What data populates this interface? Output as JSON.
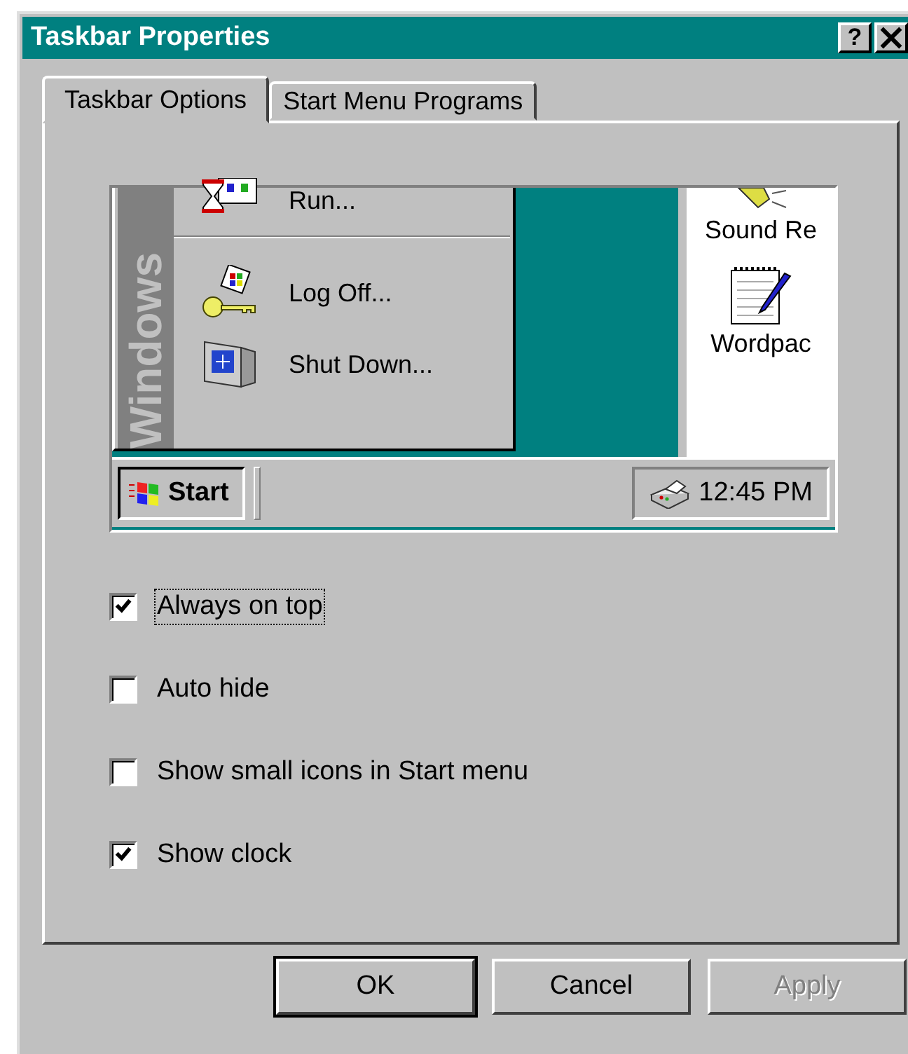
{
  "window": {
    "title": "Taskbar Properties",
    "help_button": "?"
  },
  "tabs": [
    {
      "label": "Taskbar Options",
      "selected": true
    },
    {
      "label": "Start Menu Programs",
      "selected": false
    }
  ],
  "preview": {
    "banner": "Windows",
    "menu_items": [
      {
        "label": "Run...",
        "kind": "run"
      },
      {
        "label": "Log Off...",
        "kind": "logoff"
      },
      {
        "label": "Shut Down...",
        "kind": "shutdown"
      }
    ],
    "desktop_icons": [
      {
        "label": "Sound Re",
        "kind": "speaker"
      },
      {
        "label": "Wordpac",
        "kind": "notepad"
      }
    ],
    "start_button": "Start",
    "clock": "12:45 PM"
  },
  "options": [
    {
      "label": "Always on top",
      "checked": true,
      "focused": true
    },
    {
      "label": "Auto hide",
      "checked": false,
      "focused": false
    },
    {
      "label": "Show small icons in Start menu",
      "checked": false,
      "focused": false
    },
    {
      "label": "Show clock",
      "checked": true,
      "focused": false
    }
  ],
  "buttons": [
    {
      "label": "OK",
      "default": true,
      "disabled": false
    },
    {
      "label": "Cancel",
      "default": false,
      "disabled": false
    },
    {
      "label": "Apply",
      "default": false,
      "disabled": true
    }
  ]
}
